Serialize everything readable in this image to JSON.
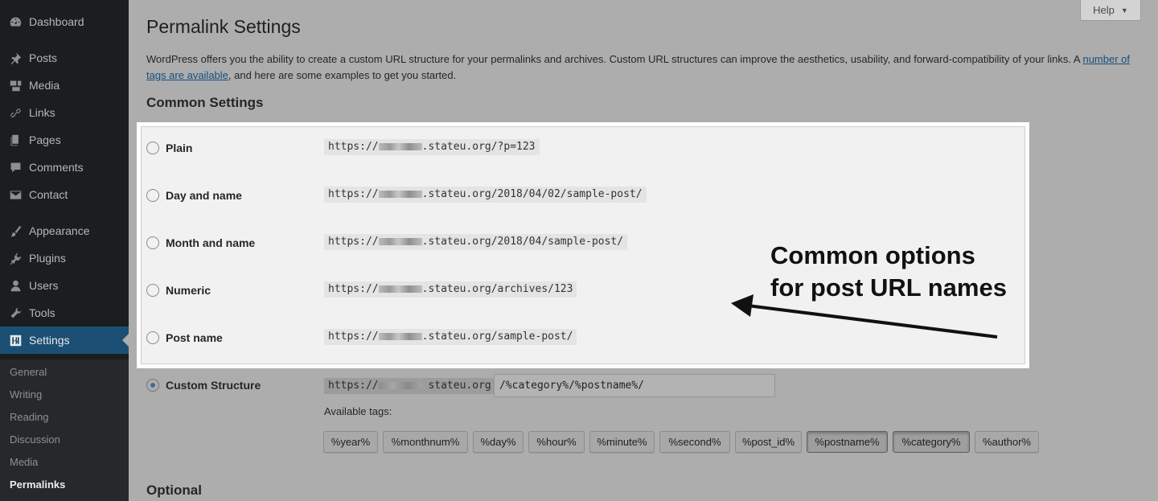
{
  "sidebar": {
    "items": [
      {
        "label": "Dashboard",
        "icon": "dashboard-icon"
      },
      {
        "label": "Posts",
        "icon": "pin-icon"
      },
      {
        "label": "Media",
        "icon": "media-icon"
      },
      {
        "label": "Links",
        "icon": "link-icon"
      },
      {
        "label": "Pages",
        "icon": "page-icon"
      },
      {
        "label": "Comments",
        "icon": "comment-icon"
      },
      {
        "label": "Contact",
        "icon": "mail-icon"
      },
      {
        "label": "Appearance",
        "icon": "brush-icon"
      },
      {
        "label": "Plugins",
        "icon": "plugin-icon"
      },
      {
        "label": "Users",
        "icon": "user-icon"
      },
      {
        "label": "Tools",
        "icon": "wrench-icon"
      },
      {
        "label": "Settings",
        "icon": "settings-icon"
      }
    ],
    "submenu": [
      "General",
      "Writing",
      "Reading",
      "Discussion",
      "Media",
      "Permalinks"
    ],
    "current_submenu": "Permalinks"
  },
  "help": {
    "label": "Help"
  },
  "page": {
    "title": "Permalink Settings",
    "intro_before": "WordPress offers you the ability to create a custom URL structure for your permalinks and archives. Custom URL structures can improve the aesthetics, usability, and forward-compatibility of your links. A ",
    "intro_link": "number of tags are available",
    "intro_after": ", and here are some examples to get you started.",
    "common_heading": "Common Settings",
    "optional_heading": "Optional"
  },
  "options": [
    {
      "label": "Plain",
      "url_prefix": "https://",
      "url_suffix": ".stateu.org/?p=123",
      "selected": false
    },
    {
      "label": "Day and name",
      "url_prefix": "https://",
      "url_suffix": ".stateu.org/2018/04/02/sample-post/",
      "selected": false
    },
    {
      "label": "Month and name",
      "url_prefix": "https://",
      "url_suffix": ".stateu.org/2018/04/sample-post/",
      "selected": false
    },
    {
      "label": "Numeric",
      "url_prefix": "https://",
      "url_suffix": ".stateu.org/archives/123",
      "selected": false
    },
    {
      "label": "Post name",
      "url_prefix": "https://",
      "url_suffix": ".stateu.org/sample-post/",
      "selected": false
    }
  ],
  "custom": {
    "label": "Custom Structure",
    "url_prefix": "https://",
    "url_suffix": "stateu.org",
    "value": "/%category%/%postname%/",
    "selected": true,
    "available_tags_label": "Available tags:",
    "tags": [
      {
        "label": "%year%",
        "pressed": false
      },
      {
        "label": "%monthnum%",
        "pressed": false
      },
      {
        "label": "%day%",
        "pressed": false
      },
      {
        "label": "%hour%",
        "pressed": false
      },
      {
        "label": "%minute%",
        "pressed": false
      },
      {
        "label": "%second%",
        "pressed": false
      },
      {
        "label": "%post_id%",
        "pressed": false
      },
      {
        "label": "%postname%",
        "pressed": true
      },
      {
        "label": "%category%",
        "pressed": true
      },
      {
        "label": "%author%",
        "pressed": false
      }
    ]
  },
  "annotation": {
    "line1": "Common options",
    "line2": "for post URL names"
  },
  "colors": {
    "sidebar_bg": "#1b1e21",
    "active_bg": "#1a4f73",
    "overlay_bg": "#adadad",
    "highlight_box": "#ffffff"
  }
}
